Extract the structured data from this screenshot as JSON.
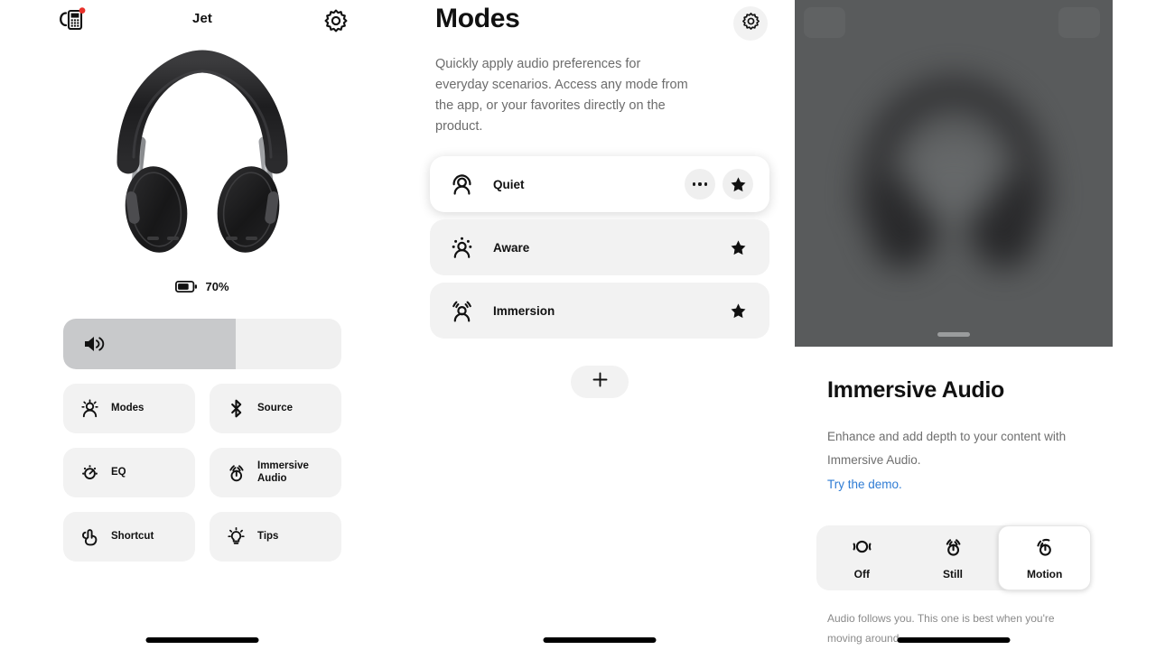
{
  "device_panel": {
    "title": "Jet",
    "notification_icon": "headphone-device-icon",
    "settings_icon": "gear-icon",
    "product_image_alt": "black-over-ear-headphones",
    "battery": {
      "percent_label": "70%",
      "level": 70
    },
    "volume": {
      "icon": "speaker-icon",
      "level": 62
    },
    "tiles": [
      {
        "icon": "modes-person-icon",
        "label": "Modes"
      },
      {
        "icon": "bluetooth-icon",
        "label": "Source"
      },
      {
        "icon": "eq-dial-icon",
        "label": "EQ"
      },
      {
        "icon": "immersive-audio-icon",
        "label": "Immersive\nAudio"
      },
      {
        "icon": "shortcut-tap-icon",
        "label": "Shortcut"
      },
      {
        "icon": "lightbulb-icon",
        "label": "Tips"
      }
    ]
  },
  "modes_panel": {
    "title": "Modes",
    "settings_icon": "gear-icon",
    "description": "Quickly apply audio preferences for everyday scenarios. Access any mode from the app, or your favorites directly on the product.",
    "modes": [
      {
        "name": "Quiet",
        "icon": "quiet-person-icon",
        "active": true,
        "has_more": true,
        "favorite": true
      },
      {
        "name": "Aware",
        "icon": "aware-person-icon",
        "active": false,
        "has_more": false,
        "favorite": true
      },
      {
        "name": "Immersion",
        "icon": "immersion-person-icon",
        "active": false,
        "has_more": false,
        "favorite": true
      }
    ],
    "add_button_icon": "plus-icon",
    "more_icon": "ellipsis-icon",
    "favorite_icon": "star-filled-icon"
  },
  "immersive_panel": {
    "background": "blurred-headphones-backdrop",
    "drag_handle": "sheet-drag-handle",
    "title": "Immersive Audio",
    "description": "Enhance and add depth to your content with Immersive Audio.",
    "link_label": "Try the demo.",
    "link_color": "#2f7cd4",
    "options": [
      {
        "label": "Off",
        "icon": "immersive-off-icon",
        "selected": false
      },
      {
        "label": "Still",
        "icon": "immersive-still-icon",
        "selected": false
      },
      {
        "label": "Motion",
        "icon": "immersive-motion-icon",
        "selected": true
      }
    ],
    "note": "Audio follows you. This one is best when you're moving around."
  },
  "colors": {
    "accent_link": "#2f7cd4",
    "tile_bg": "#f2f2f2",
    "slider_fill": "#c8c9cb",
    "sheet_backdrop": "#595b5c",
    "notification_dot": "#e8312a"
  }
}
